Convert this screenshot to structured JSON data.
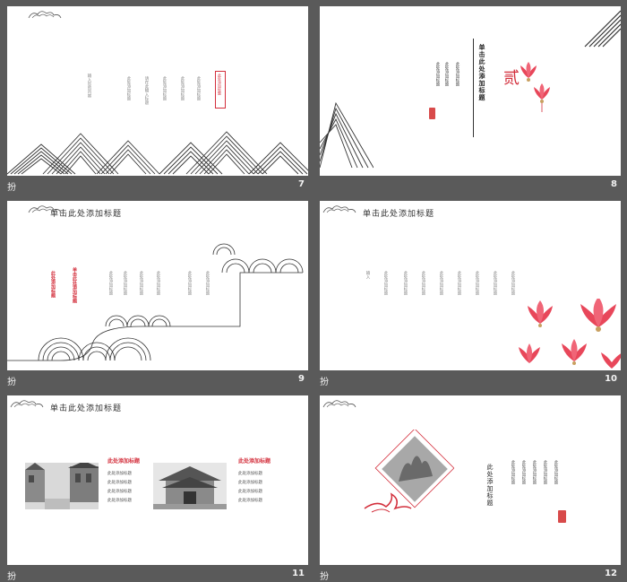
{
  "caption_mark": "扮",
  "slides": [
    {
      "number": "7",
      "vertical_texts": [
        "输入您的内容",
        "此处添加标题",
        "请在此输入标题",
        "此处添加标题",
        "此处添加标题",
        "此处添加标题"
      ],
      "stamp_text": "此处添加标题"
    },
    {
      "number": "8",
      "heading": "单击此处添加标题",
      "char": "贰",
      "vertical_texts": [
        "此处添加标题",
        "此处添加标题",
        "此处添加标题"
      ]
    },
    {
      "number": "9",
      "title": "单击此处添加标题",
      "red_vertical_1": "此处添加标题",
      "red_vertical_2": "单击此处添加标题",
      "vertical_texts": [
        "此处添加标题",
        "此处添加标题",
        "此处添加标题",
        "此处添加标题",
        "此处添加标题",
        "此处添加标题"
      ]
    },
    {
      "number": "10",
      "title": "单击此处添加标题",
      "vertical_texts": [
        "输入",
        "此处添加标题",
        "此处添加标题",
        "此处添加标题",
        "此处添加标题",
        "此处添加标题",
        "此处添加标题",
        "此处添加标题",
        "此处添加标题"
      ]
    },
    {
      "number": "11",
      "title": "单击此处添加标题",
      "left_heading": "此处添加标题",
      "right_heading": "此处添加标题",
      "left_lines": [
        "此处添加标题",
        "此处添加标题",
        "此处添加标题",
        "此处添加标题"
      ],
      "right_lines": [
        "此处添加标题",
        "此处添加标题",
        "此处添加标题",
        "此处添加标题"
      ]
    },
    {
      "number": "12",
      "heading": "此处添加标题",
      "vertical_texts": [
        "此处添加标题",
        "此处添加标题",
        "此处添加标题",
        "此处添加标题",
        "此处添加标题"
      ]
    }
  ],
  "colors": {
    "background": "#5a5a5a",
    "accent_red": "#d32f3c",
    "flower_pink": "#e8475a"
  }
}
